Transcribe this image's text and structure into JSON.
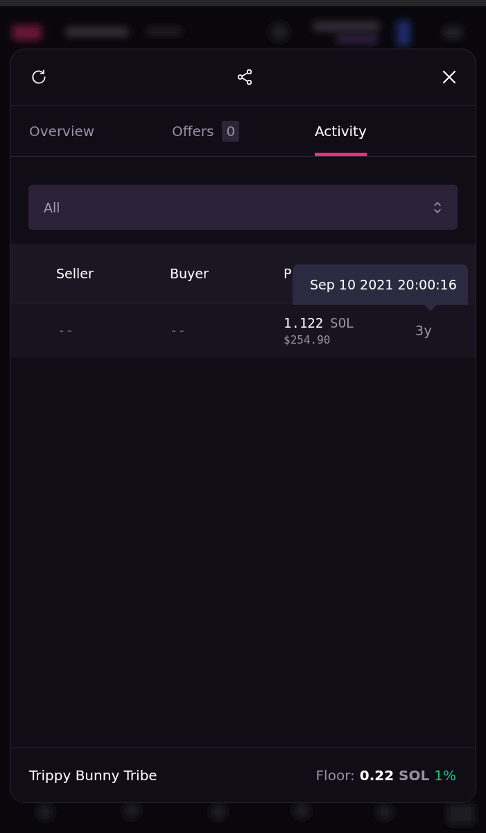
{
  "tabs": [
    {
      "label": "Overview",
      "selected": false
    },
    {
      "label": "Offers",
      "count": "0",
      "selected": false
    },
    {
      "label": "Activity",
      "selected": true
    }
  ],
  "filter": {
    "value": "All"
  },
  "table": {
    "columns": [
      "Seller",
      "Buyer",
      "P"
    ],
    "rows": [
      {
        "seller": "--",
        "buyer": "--",
        "price": "1.122",
        "unit": "SOL",
        "usd": "$254.90",
        "time": "3y"
      }
    ]
  },
  "tooltip": "Sep 10 2021 20:00:16",
  "footer": {
    "collection": "Trippy Bunny Tribe",
    "floor_label": "Floor:",
    "floor_value": "0.22",
    "floor_unit": "SOL",
    "change": "1%"
  }
}
